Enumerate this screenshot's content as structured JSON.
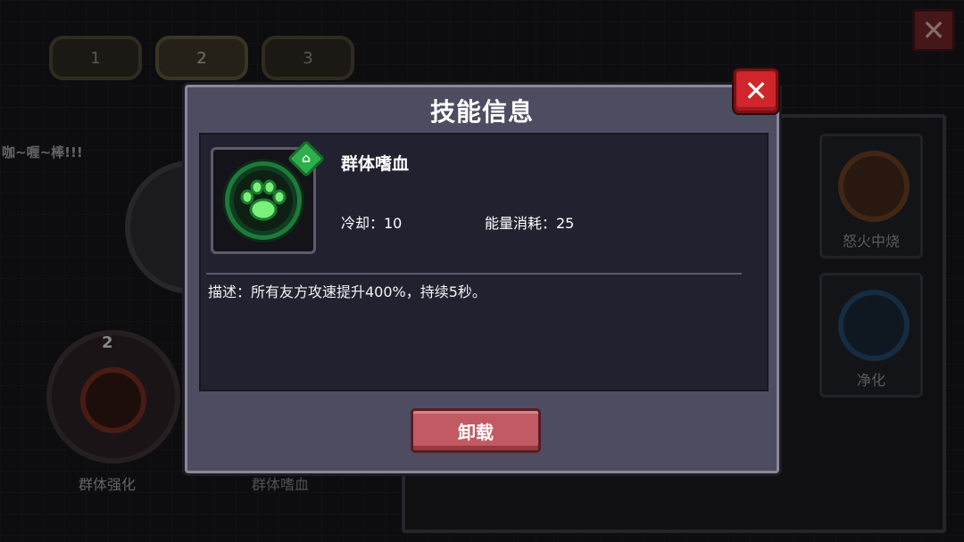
{
  "background": {
    "tabs": [
      "1",
      "2",
      "3"
    ],
    "close_label": "✕",
    "chat_text": "咖~喱~棒!!!",
    "left_slot_level": "2",
    "left_skill_label": "群体强化",
    "bottom_skill_label": "群体嗜血",
    "right_skills": [
      {
        "label": "怒火中烧"
      },
      {
        "label": "净化"
      }
    ]
  },
  "modal": {
    "title": "技能信息",
    "close_label": "✕",
    "skill_name": "群体嗜血",
    "cooldown": "冷却：10",
    "energy_cost": "能量消耗：25",
    "description": "描述：所有友方攻速提升400%，持续5秒。",
    "unload_button": "卸载",
    "icon": "paw-icon",
    "badge_icon": "home-icon"
  },
  "colors": {
    "modal_bg": "#4e4c60",
    "inner_bg": "#222130",
    "close_red": "#d0252a",
    "unload_btn": "#c15a62",
    "skill_green": "#2fae4c"
  }
}
